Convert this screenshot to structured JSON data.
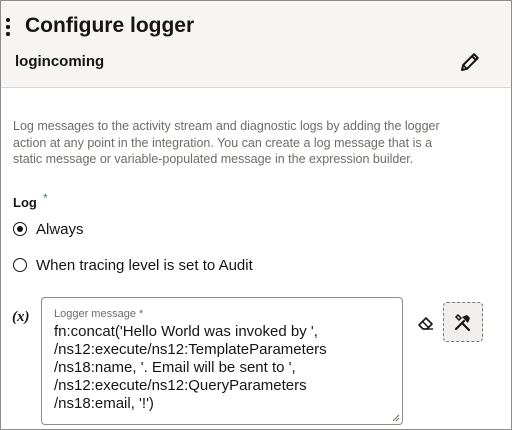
{
  "header": {
    "title": "Configure logger",
    "action_name": "logincoming"
  },
  "description": "Log messages to the activity stream and diagnostic logs by adding the logger action at any point in the integration. You can create a log message that is a static message or variable-populated message in the expression builder.",
  "log": {
    "label": "Log",
    "required_marker": "*",
    "options": [
      {
        "label": "Always",
        "selected": true
      },
      {
        "label": "When tracing level is set to Audit",
        "selected": false
      }
    ]
  },
  "expression": {
    "toggle_label": "(x)",
    "field_label": "Logger message *",
    "value": "fn:concat('Hello World was invoked by ',\n/ns12:execute/ns12:TemplateParameters\n/ns18:name, '. Email will be sent to ',\n/ns12:execute/ns12:QueryParameters\n/ns18:email, '!')"
  },
  "icons": {
    "drag": "drag-handle-icon",
    "edit": "pencil-icon",
    "clear": "eraser-icon",
    "builder": "tools-icon"
  },
  "colors": {
    "header_bg": "#f6f5f3",
    "required_star": "#227e9e",
    "text": "#161513",
    "muted_text": "#6f6c68"
  }
}
